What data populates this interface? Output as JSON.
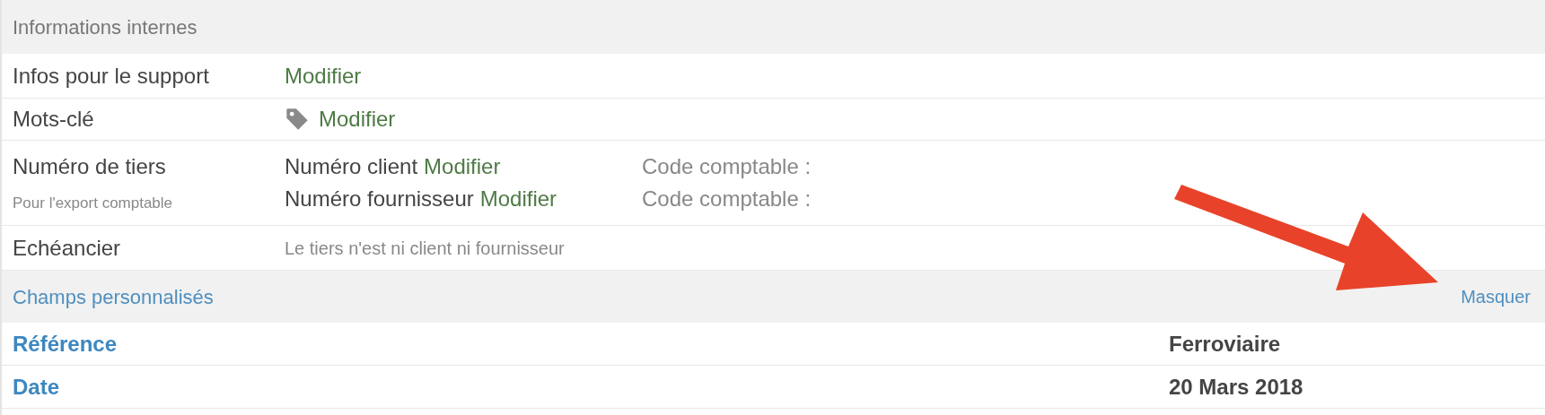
{
  "internal_section": {
    "title": "Informations internes"
  },
  "internal_rows": [
    {
      "kind": "link",
      "label": "Infos pour le support",
      "link": "Modifier"
    },
    {
      "kind": "tag_link",
      "label": "Mots-clé",
      "link": "Modifier"
    },
    {
      "kind": "numbers",
      "label": "Numéro de tiers",
      "sublabel": "Pour l'export comptable",
      "entries": [
        {
          "name": "Numéro client",
          "link": "Modifier",
          "code_label": "Code comptable :"
        },
        {
          "name": "Numéro fournisseur",
          "link": "Modifier",
          "code_label": "Code comptable :"
        }
      ]
    },
    {
      "kind": "note",
      "label": "Echéancier",
      "note": "Le tiers n'est ni client ni fournisseur"
    }
  ],
  "custom_section": {
    "title": "Champs personnalisés",
    "toggle": "Masquer"
  },
  "custom_fields": [
    {
      "label": "Référence",
      "value": "Ferroviaire"
    },
    {
      "label": "Date",
      "value": "20 Mars 2018"
    }
  ],
  "annotation": {
    "kind": "arrow"
  }
}
